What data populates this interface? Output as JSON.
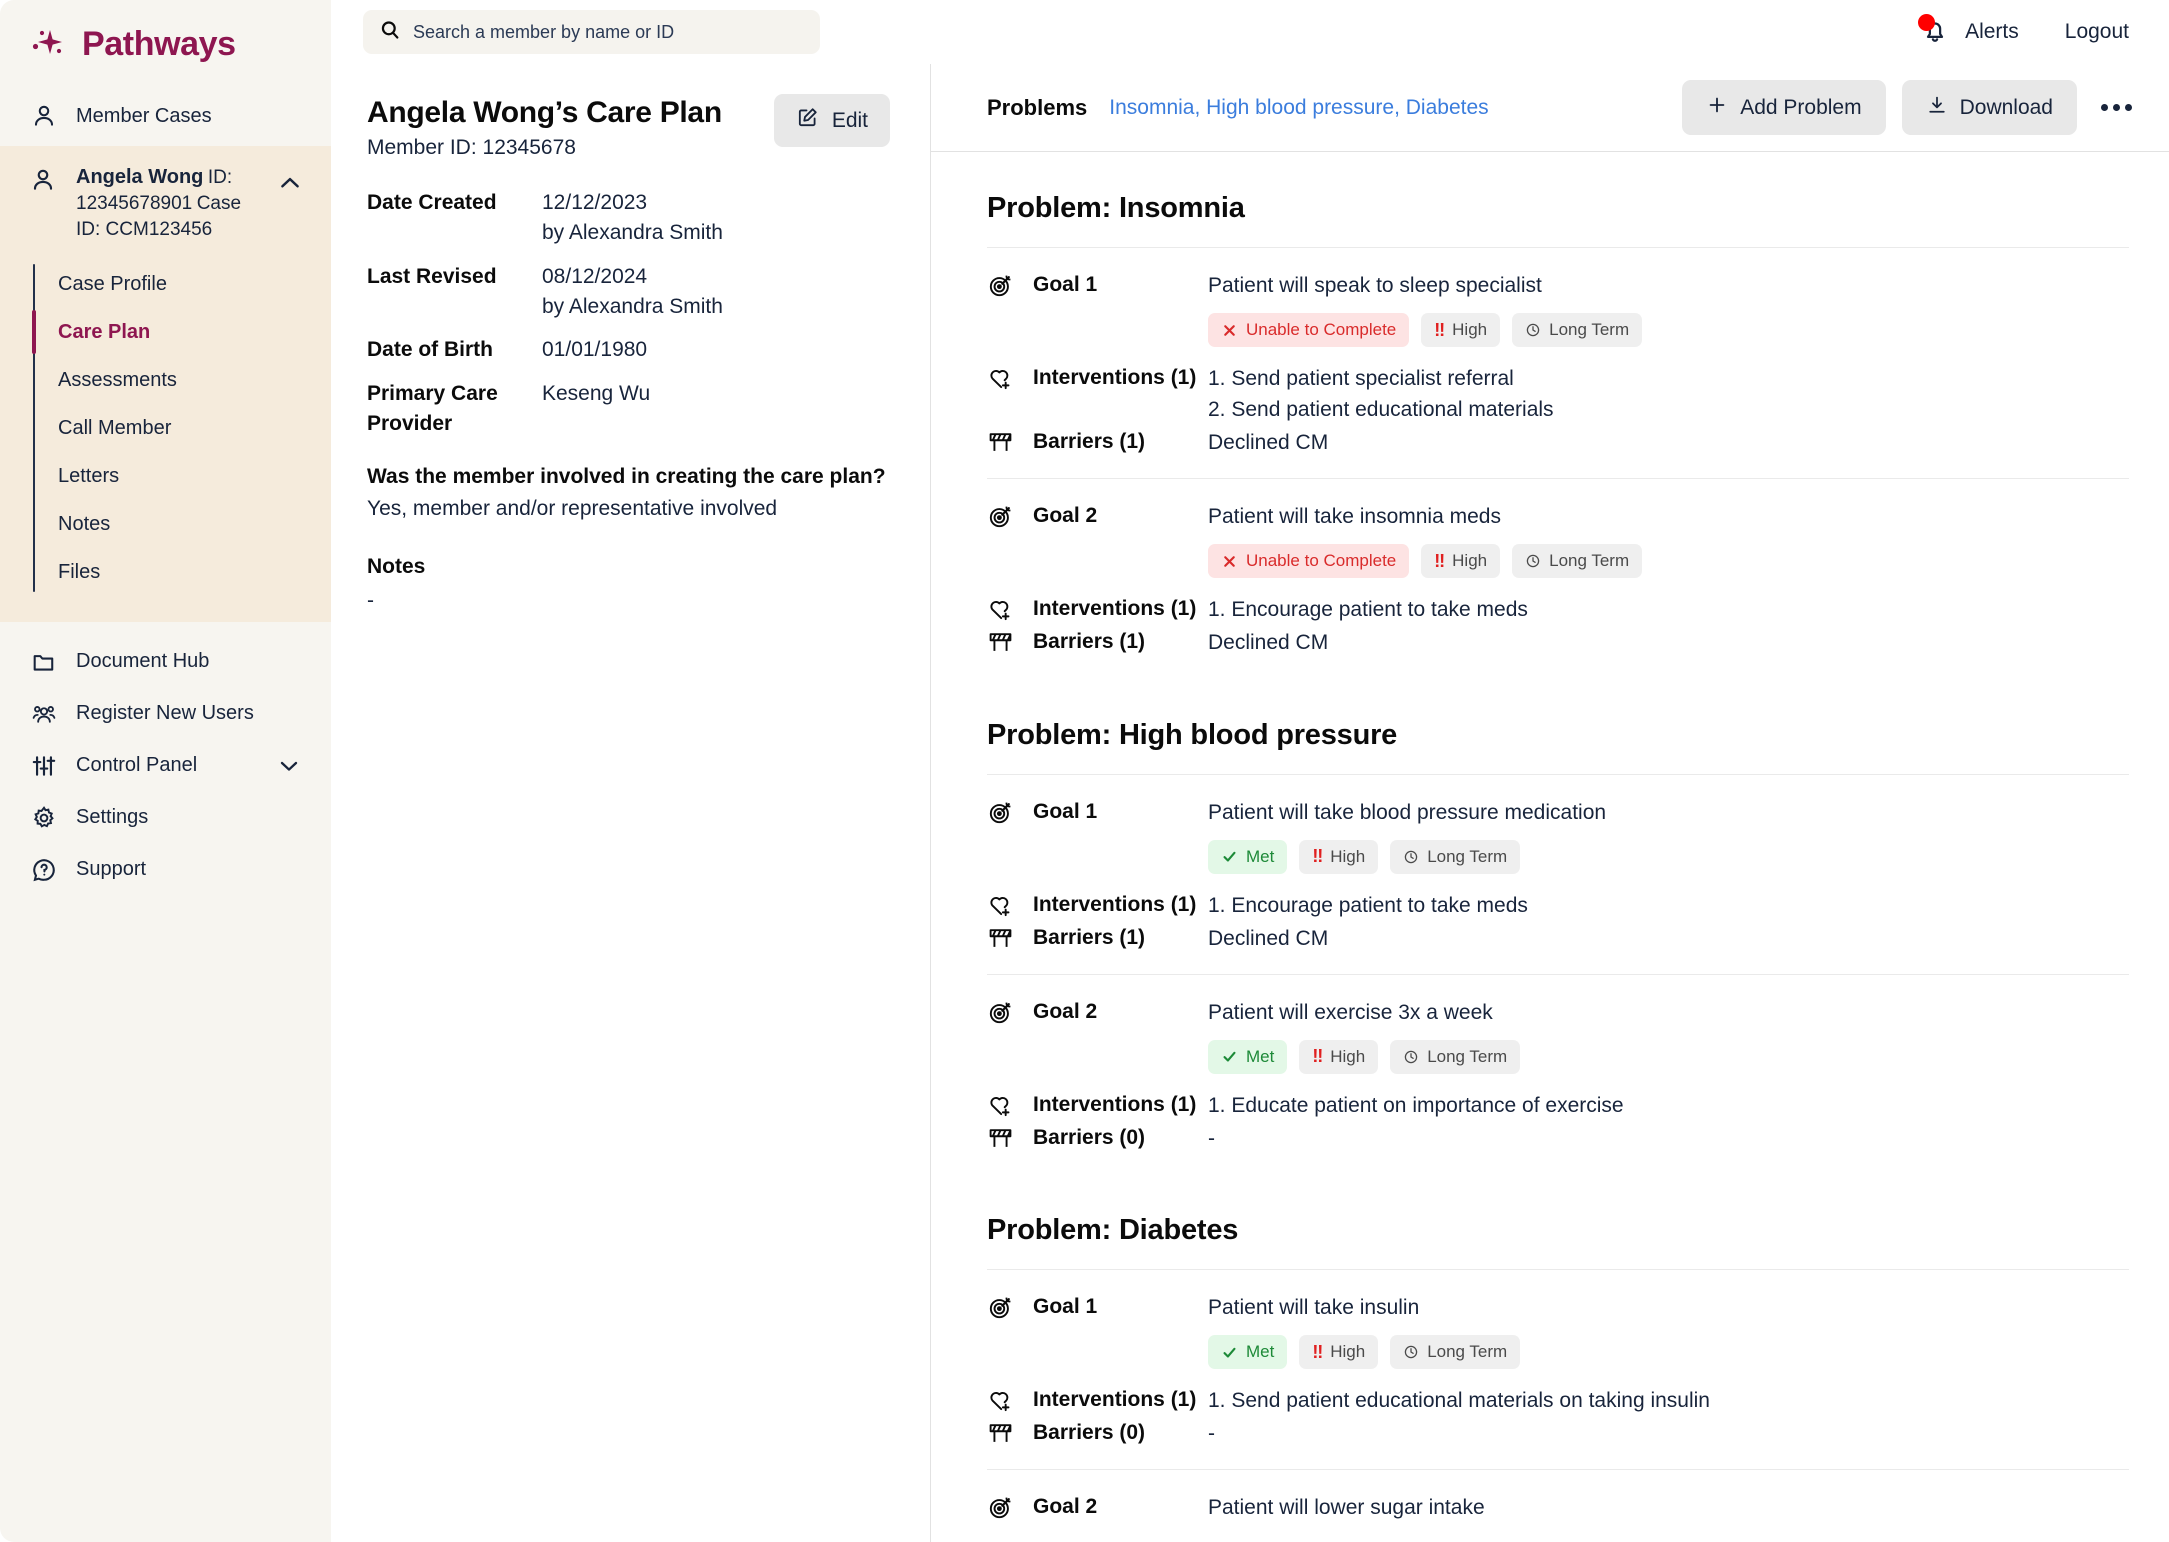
{
  "brand": {
    "name": "Pathways",
    "logo_icon": "sparkle-icon"
  },
  "topbar": {
    "search": {
      "placeholder": "Search a member by name or ID",
      "value": "",
      "icon": "search-icon"
    },
    "alerts_label": "Alerts",
    "alerts_icon": "bell-icon",
    "has_alert_badge": true,
    "logout_label": "Logout"
  },
  "sidebar": {
    "member_cases": {
      "label": "Member Cases",
      "icon": "user-icon"
    },
    "member": {
      "name": "Angela Wong",
      "member_id": "ID: 12345678901",
      "case_id": "Case ID: CCM123456",
      "icon": "user-icon",
      "collapse_icon": "chevron-up-icon",
      "expanded": true
    },
    "sub_items": [
      {
        "label": "Case Profile",
        "active": false
      },
      {
        "label": "Care Plan",
        "active": true
      },
      {
        "label": "Assessments",
        "active": false
      },
      {
        "label": "Call Member",
        "active": false
      },
      {
        "label": "Letters",
        "active": false
      },
      {
        "label": "Notes",
        "active": false
      },
      {
        "label": "Files",
        "active": false
      }
    ],
    "bottom_items": [
      {
        "label": "Document Hub",
        "icon": "folder-icon",
        "has_chevron": false
      },
      {
        "label": "Register New Users",
        "icon": "users-group-icon",
        "has_chevron": false
      },
      {
        "label": "Control Panel",
        "icon": "sliders-icon",
        "has_chevron": true
      },
      {
        "label": "Settings",
        "icon": "gear-icon",
        "has_chevron": false
      },
      {
        "label": "Support",
        "icon": "question-circle-icon",
        "has_chevron": false
      }
    ]
  },
  "detail": {
    "title": "Angela Wong’s Care Plan",
    "subtitle": "Member ID: 12345678",
    "edit_label": "Edit",
    "edit_icon": "pencil-square-icon",
    "fields": [
      {
        "key": "Date Created",
        "value": "12/12/2023",
        "value2": "by Alexandra Smith"
      },
      {
        "key": "Last Revised",
        "value": "08/12/2024",
        "value2": "by Alexandra Smith"
      },
      {
        "key": "Date of Birth",
        "value": "01/01/1980",
        "value2": ""
      },
      {
        "key": "Primary Care Provider",
        "value": "Keseng Wu",
        "value2": ""
      }
    ],
    "question": "Was the member involved in creating the care plan?",
    "answer": "Yes, member and/or representative involved",
    "notes_label": "Notes",
    "notes_value": "-"
  },
  "problems_bar": {
    "label": "Problems",
    "list": "Insomnia, High blood pressure, Diabetes",
    "add_label": "Add Problem",
    "add_icon": "plus-icon",
    "download_label": "Download",
    "download_icon": "download-icon",
    "more_icon": "kebab-icon"
  },
  "labels": {
    "goal_icon": "target-icon",
    "interventions_icon": "heart-plus-icon",
    "barriers_icon": "barrier-icon"
  },
  "problems": [
    {
      "title": "Problem: Insomnia",
      "goals": [
        {
          "label": "Goal 1",
          "text": "Patient will speak to sleep specialist",
          "badges": [
            {
              "text": "Unable to Complete",
              "style": "danger",
              "icon": "x-icon"
            },
            {
              "text": "High",
              "style": "neutral",
              "icon": "double-exclamation-icon"
            },
            {
              "text": "Long Term",
              "style": "neutral",
              "icon": "clock-icon"
            }
          ],
          "interventions_label": "Interventions (1)",
          "interventions": [
            "1. Send patient specialist referral",
            "2. Send patient educational materials"
          ],
          "barriers_label": "Barriers (1)",
          "barriers": "Declined CM"
        },
        {
          "label": "Goal 2",
          "text": "Patient will take insomnia meds",
          "badges": [
            {
              "text": "Unable to Complete",
              "style": "danger",
              "icon": "x-icon"
            },
            {
              "text": "High",
              "style": "neutral",
              "icon": "double-exclamation-icon"
            },
            {
              "text": "Long Term",
              "style": "neutral",
              "icon": "clock-icon"
            }
          ],
          "interventions_label": "Interventions (1)",
          "interventions": [
            "1. Encourage patient to take meds"
          ],
          "barriers_label": "Barriers (1)",
          "barriers": "Declined CM"
        }
      ]
    },
    {
      "title": "Problem: High blood pressure",
      "goals": [
        {
          "label": "Goal 1",
          "text": "Patient will take blood pressure medication",
          "badges": [
            {
              "text": "Met",
              "style": "success",
              "icon": "check-icon"
            },
            {
              "text": "High",
              "style": "neutral",
              "icon": "double-exclamation-icon"
            },
            {
              "text": "Long Term",
              "style": "neutral",
              "icon": "clock-icon"
            }
          ],
          "interventions_label": "Interventions (1)",
          "interventions": [
            "1. Encourage patient to take meds"
          ],
          "barriers_label": "Barriers (1)",
          "barriers": "Declined CM"
        },
        {
          "label": "Goal 2",
          "text": "Patient will exercise 3x a week",
          "badges": [
            {
              "text": "Met",
              "style": "success",
              "icon": "check-icon"
            },
            {
              "text": "High",
              "style": "neutral",
              "icon": "double-exclamation-icon"
            },
            {
              "text": "Long Term",
              "style": "neutral",
              "icon": "clock-icon"
            }
          ],
          "interventions_label": "Interventions (1)",
          "interventions": [
            "1. Educate patient on importance of exercise"
          ],
          "barriers_label": "Barriers (0)",
          "barriers": "-"
        }
      ]
    },
    {
      "title": "Problem: Diabetes",
      "goals": [
        {
          "label": "Goal 1",
          "text": "Patient will take insulin",
          "badges": [
            {
              "text": "Met",
              "style": "success",
              "icon": "check-icon"
            },
            {
              "text": "High",
              "style": "neutral",
              "icon": "double-exclamation-icon"
            },
            {
              "text": "Long Term",
              "style": "neutral",
              "icon": "clock-icon"
            }
          ],
          "interventions_label": "Interventions (1)",
          "interventions": [
            "1. Send patient educational materials on taking insulin"
          ],
          "barriers_label": "Barriers (0)",
          "barriers": "-"
        },
        {
          "label": "Goal 2",
          "text": "Patient will lower sugar intake",
          "badges": [],
          "interventions_label": "",
          "interventions": [],
          "barriers_label": "",
          "barriers": ""
        }
      ]
    }
  ],
  "colors": {
    "brand_magenta": "#8E1650",
    "sidebar_bg": "#F7F5F0",
    "member_bg": "#F5EBDC",
    "text_dark": "#18243B",
    "link_blue": "#3B7DDD",
    "danger": "#D92B2B",
    "danger_bg": "#FDE3E3",
    "success": "#1D8A38",
    "success_bg": "#E3F8E7",
    "neutral_bg": "#EFEFEF",
    "alert_red": "#FF0000"
  }
}
